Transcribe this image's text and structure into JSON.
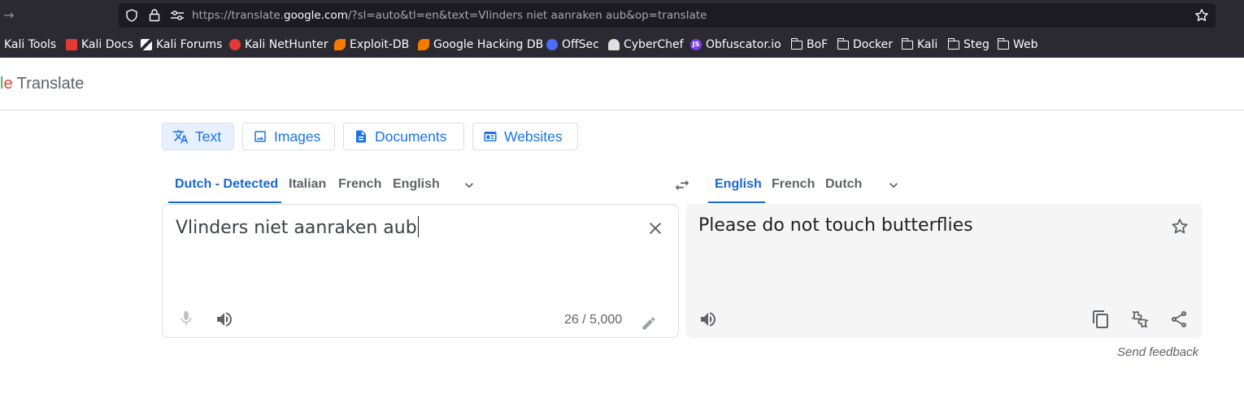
{
  "browser": {
    "url_prefix": "https://translate.",
    "url_host": "google.com",
    "url_suffix": "/?sl=auto&tl=en&text=Vlinders niet aanraken aub&op=translate"
  },
  "bookmarks": [
    {
      "label": "Kali Tools",
      "type": "link",
      "icon_color": "#367bf0"
    },
    {
      "label": "Kali Docs",
      "type": "link",
      "icon_color": "#e53935"
    },
    {
      "label": "Kali Forums",
      "type": "link",
      "icon_color": "#000000"
    },
    {
      "label": "Kali NetHunter",
      "type": "link",
      "icon_color": "#e53935"
    },
    {
      "label": "Exploit-DB",
      "type": "link",
      "icon_color": "#f57c00"
    },
    {
      "label": "Google Hacking DB",
      "type": "link",
      "icon_color": "#f57c00"
    },
    {
      "label": "OffSec",
      "type": "link",
      "icon_color": "#4a6cf7"
    },
    {
      "label": "CyberChef",
      "type": "link",
      "icon_color": "#e0e0e0"
    },
    {
      "label": "Obfuscator.io",
      "type": "link",
      "icon_color": "#7b3fe4"
    },
    {
      "label": "BoF",
      "type": "folder"
    },
    {
      "label": "Docker",
      "type": "folder"
    },
    {
      "label": "Kali",
      "type": "folder"
    },
    {
      "label": "Steg",
      "type": "folder"
    },
    {
      "label": "Web",
      "type": "folder"
    }
  ],
  "header": {
    "brand_tail_l": "l",
    "brand_tail_e": "e",
    "product": "Translate"
  },
  "modes": {
    "text": "Text",
    "images": "Images",
    "documents": "Documents",
    "websites": "Websites",
    "active": "Text"
  },
  "source_langs": [
    "Dutch - Detected",
    "Italian",
    "French",
    "English"
  ],
  "target_langs": [
    "English",
    "French",
    "Dutch"
  ],
  "source": {
    "text": "Vlinders niet aanraken aub",
    "char_count": "26 / 5,000"
  },
  "target": {
    "text": "Please do not touch butterflies"
  },
  "footer": {
    "feedback": "Send feedback"
  },
  "colors": {
    "accent": "#1a73e8",
    "chrome_bg": "#2b2a33"
  }
}
